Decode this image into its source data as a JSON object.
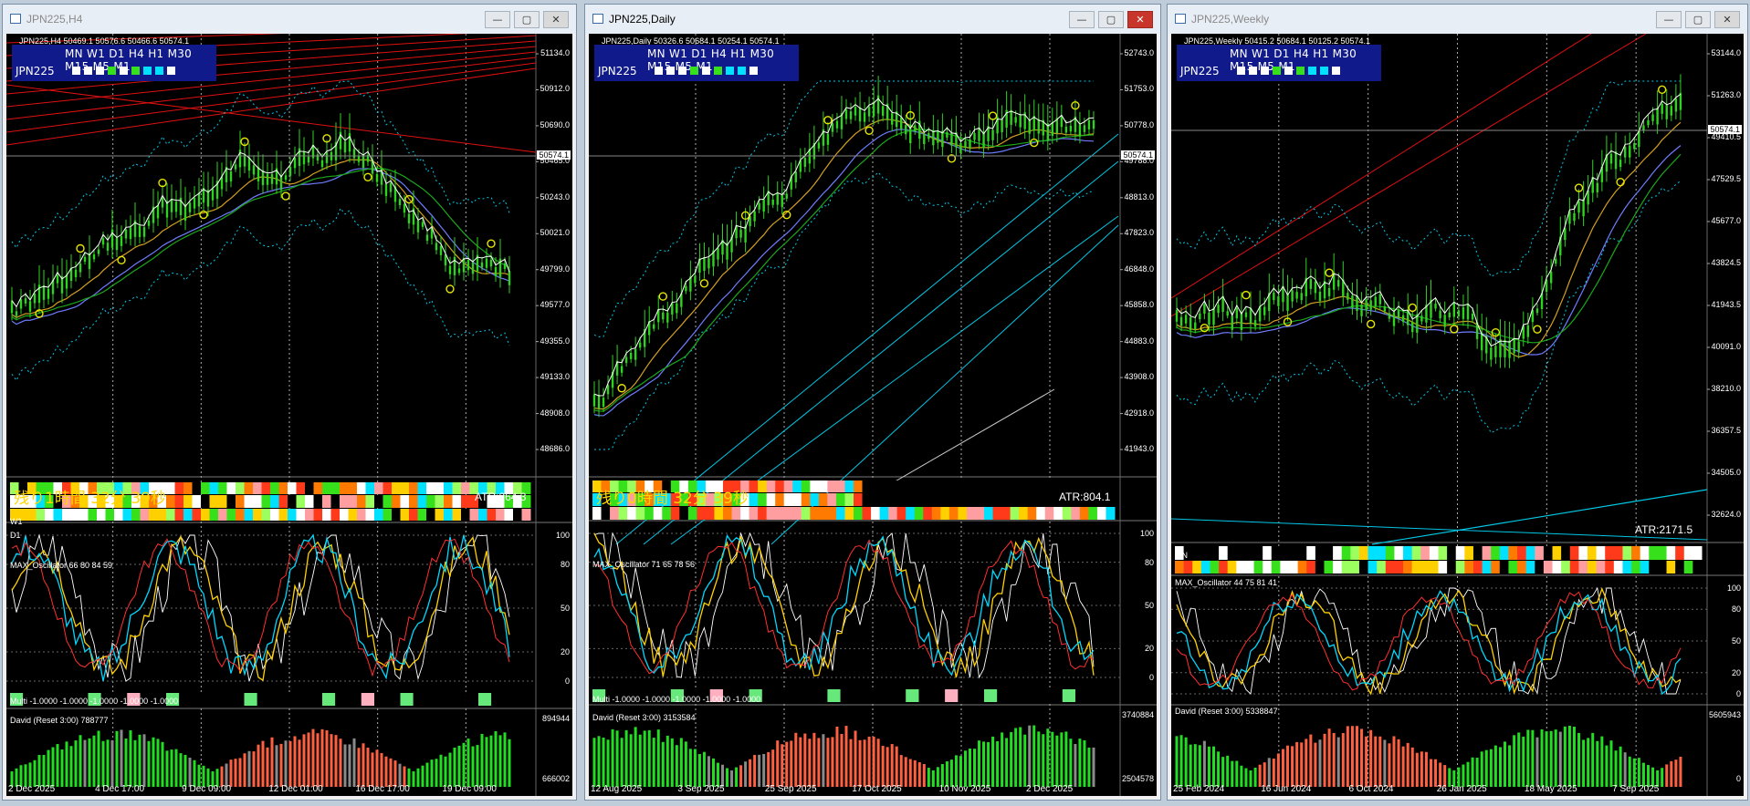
{
  "windows": [
    {
      "title": "JPN225,H4",
      "active": false,
      "header_line": "JPN225,H4  50469.1 50576.6 50466.6 50574.1",
      "tf_labels": "MN W1 D1 H4 H1 M30 M15 M5 M1",
      "symbol": "JPN225",
      "remain_text": "残り1時間 32分 39秒",
      "atr_text": "ATR:264.3",
      "prices": [
        "51134.0",
        "50912.0",
        "50690.0",
        "50465.0",
        "50243.0",
        "50021.0",
        "49799.0",
        "49577.0",
        "49355.0",
        "49133.0",
        "48908.0",
        "48686.0"
      ],
      "current_price": "50574.1",
      "stripe_labels": [
        "W1",
        "D1"
      ],
      "osc_title": "MAX_Oscillator 66 80 84 59",
      "osc_levels": [
        "100",
        "80",
        "50",
        "20",
        "0"
      ],
      "multi_title": "Multi -1.0000 -1.0000 -1.0000 -1.0000 -1.0000",
      "david_title": "David (Reset 3:00) 788777",
      "david_top": "894944",
      "david_bottom": "666002",
      "dates": [
        "2 Dec 2025",
        "4 Dec 17:00",
        "9 Dec 09:00",
        "12 Dec 01:00",
        "16 Dec 17:00",
        "19 Dec 09:00"
      ]
    },
    {
      "title": "JPN225,Daily",
      "active": true,
      "header_line": "JPN225,Daily  50326.6 50684.1 50254.1 50574.1",
      "tf_labels": "MN W1 D1 H4 H1 M30 M15 M5 M1",
      "symbol": "JPN225",
      "remain_text": "残り0時間 32分 39秒",
      "atr_text": "ATR:804.1",
      "prices": [
        "52743.0",
        "51753.0",
        "50778.0",
        "49788.0",
        "48813.0",
        "47823.0",
        "46848.0",
        "45858.0",
        "44883.0",
        "43908.0",
        "42918.0",
        "41943.0"
      ],
      "current_price": "50574.1",
      "osc_title": "MAX_Oscillator 71 65 78 56",
      "osc_levels": [
        "100",
        "80",
        "50",
        "20",
        "0"
      ],
      "multi_title": "Multi -1.0000 -1.0000 -1.0000 -1.0000 -1.0000",
      "david_title": "David (Reset 3:00) 3153584",
      "david_top": "3740884",
      "david_bottom": "2504578",
      "dates": [
        "12 Aug 2025",
        "3 Sep 2025",
        "25 Sep 2025",
        "17 Oct 2025",
        "10 Nov 2025",
        "2 Dec 2025"
      ]
    },
    {
      "title": "JPN225,Weekly",
      "active": false,
      "header_line": "JPN225,Weekly  50415.2 50684.1 50125.2 50574.1",
      "tf_labels": "MN W1 D1 H4 H1 M30 M15 M5 M1",
      "symbol": "JPN225",
      "atr_text": "ATR:2171.5",
      "prices": [
        "53144.0",
        "51263.0",
        "49410.5",
        "47529.5",
        "45677.0",
        "43824.5",
        "41943.5",
        "40091.0",
        "38210.0",
        "36357.5",
        "34505.0",
        "32624.0"
      ],
      "current_price": "50574.1",
      "stripe_labels": [
        "MN"
      ],
      "osc_title": "MAX_Oscillator 44 75 81 41",
      "osc_levels": [
        "100",
        "80",
        "50",
        "20",
        "0"
      ],
      "david_title": "David (Reset 3:00) 5338847",
      "david_top": "5605943",
      "david_bottom": "0",
      "dates": [
        "25 Feb 2024",
        "16 Jun 2024",
        "6 Oct 2024",
        "26 Jan 2025",
        "18 May 2025",
        "7 Sep 2025"
      ]
    }
  ],
  "colors": {
    "candle": "#2fd21f",
    "ma_white": "#ffffff",
    "band_cyan": "#00c8e6",
    "signal_yellow": "#e6e600",
    "trend_red": "#e01010",
    "osc_yellow": "#ffd000",
    "osc_cyan": "#00d8ff",
    "osc_red": "#ff3030",
    "hist_green": "#22dd22",
    "hist_red": "#ff6040",
    "hist_gray": "#8a8a8a",
    "tf_box": "#101a8a",
    "remain_gold": "#ffd700"
  },
  "window_buttons": {
    "minimize": "—",
    "maximize": "▢",
    "close": "✕"
  }
}
